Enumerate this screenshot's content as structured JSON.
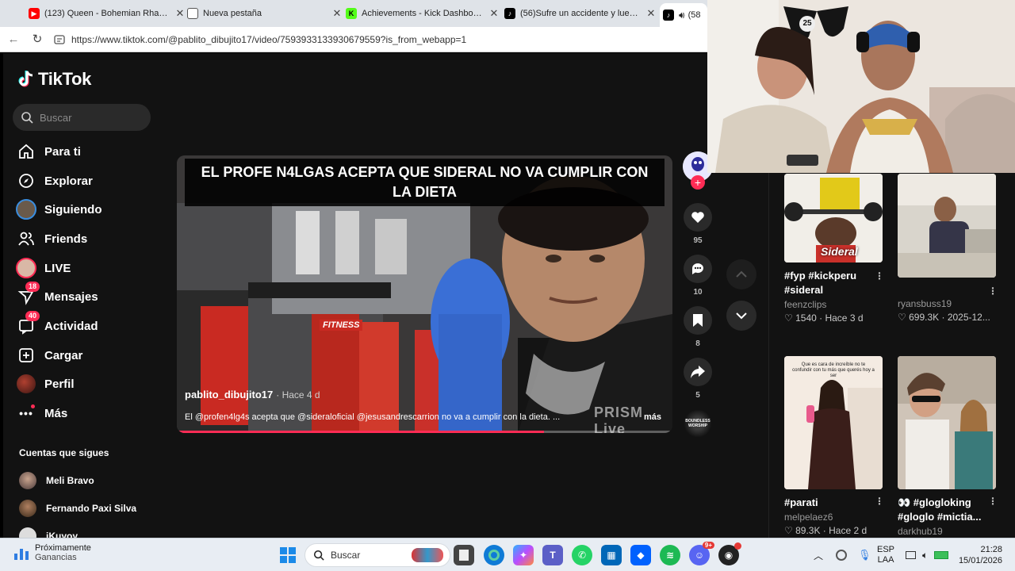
{
  "browser": {
    "tabs": [
      {
        "title": "(123) Queen - Bohemian Rhapsody",
        "favicon": "youtube-icon",
        "active": false
      },
      {
        "title": "Nueva pestaña",
        "favicon": "new-tab-icon",
        "active": false
      },
      {
        "title": "Achievements - Kick Dashboard",
        "favicon": "kick-icon",
        "active": false
      },
      {
        "title": "(56)Sufre un accidente y luego pre",
        "favicon": "tiktok-icon",
        "active": false
      },
      {
        "title": "(58",
        "favicon": "tiktok-icon",
        "active": true
      }
    ],
    "url": "https://www.tiktok.com/@pablito_dibujito17/video/7593933133930679559?is_from_webapp=1"
  },
  "sidebar": {
    "logo": "TikTok",
    "search_placeholder": "Buscar",
    "nav": [
      {
        "label": "Para ti",
        "icon": "home-icon"
      },
      {
        "label": "Explorar",
        "icon": "compass-icon"
      },
      {
        "label": "Siguiendo",
        "icon": "following-avatar-icon"
      },
      {
        "label": "Friends",
        "icon": "friends-icon"
      },
      {
        "label": "LIVE",
        "icon": "live-icon"
      },
      {
        "label": "Mensajes",
        "icon": "messages-icon",
        "badge": "18"
      },
      {
        "label": "Actividad",
        "icon": "activity-icon",
        "badge": "40"
      },
      {
        "label": "Cargar",
        "icon": "upload-icon"
      },
      {
        "label": "Perfil",
        "icon": "profile-avatar-icon"
      },
      {
        "label": "Más",
        "icon": "more-dots-icon"
      }
    ],
    "following_title": "Cuentas que sigues",
    "following": [
      {
        "name": "Meli Bravo"
      },
      {
        "name": "Fernando Paxi Silva"
      },
      {
        "name": "jKuyoy"
      }
    ]
  },
  "video": {
    "caption": "EL PROFE N4LGAS ACEPTA QUE SIDERAL NO VA CUMPLIR CON LA DIETA",
    "username": "pablito_dibujito17",
    "time_ago": "· Hace 4 d",
    "description": "El @profen4lg4s acepta que @sideraloficial @jesusandrescarrion no va a cumplir con la dieta. ...",
    "more_label": "más",
    "watermark": "PRISM Live",
    "gym_sign": "FITNESS",
    "progress": 0.74
  },
  "actions": {
    "likes": "95",
    "comments": "10",
    "saves": "8",
    "shares": "5",
    "music_disc_text": "BOUNDLESS WORSHIP"
  },
  "feed": [
    {
      "title": "#fyp #kickperu #sideral",
      "user": "feenzclips",
      "likes": "1540",
      "date": "Hace 3 d",
      "overlay": "Sideral"
    },
    {
      "title": "",
      "user": "ryansbuss19",
      "likes": "699.3K",
      "date": "2025-12..."
    },
    {
      "title": "#parati",
      "user": "melpelaez6",
      "likes": "89.3K",
      "date": "Hace 2 d",
      "overlay": "Que es cara de increíble no te confundir con tu más que querés hoy a ser"
    },
    {
      "title": "👀 #glogloking #gloglo #mictia...",
      "user": "darkhub19",
      "likes": "",
      "date": ""
    }
  ],
  "webcam": {
    "jersey_number": "25"
  },
  "taskbar": {
    "widget_title": "Próximamente",
    "widget_subtitle": "Ganancias",
    "search_placeholder": "Buscar",
    "lang_top": "ESP",
    "lang_bottom": "LAA",
    "time": "21:28",
    "date": "15/01/2026",
    "discord_badge": "9+"
  },
  "colors": {
    "accent": "#fe2c55",
    "bg": "#121212"
  }
}
